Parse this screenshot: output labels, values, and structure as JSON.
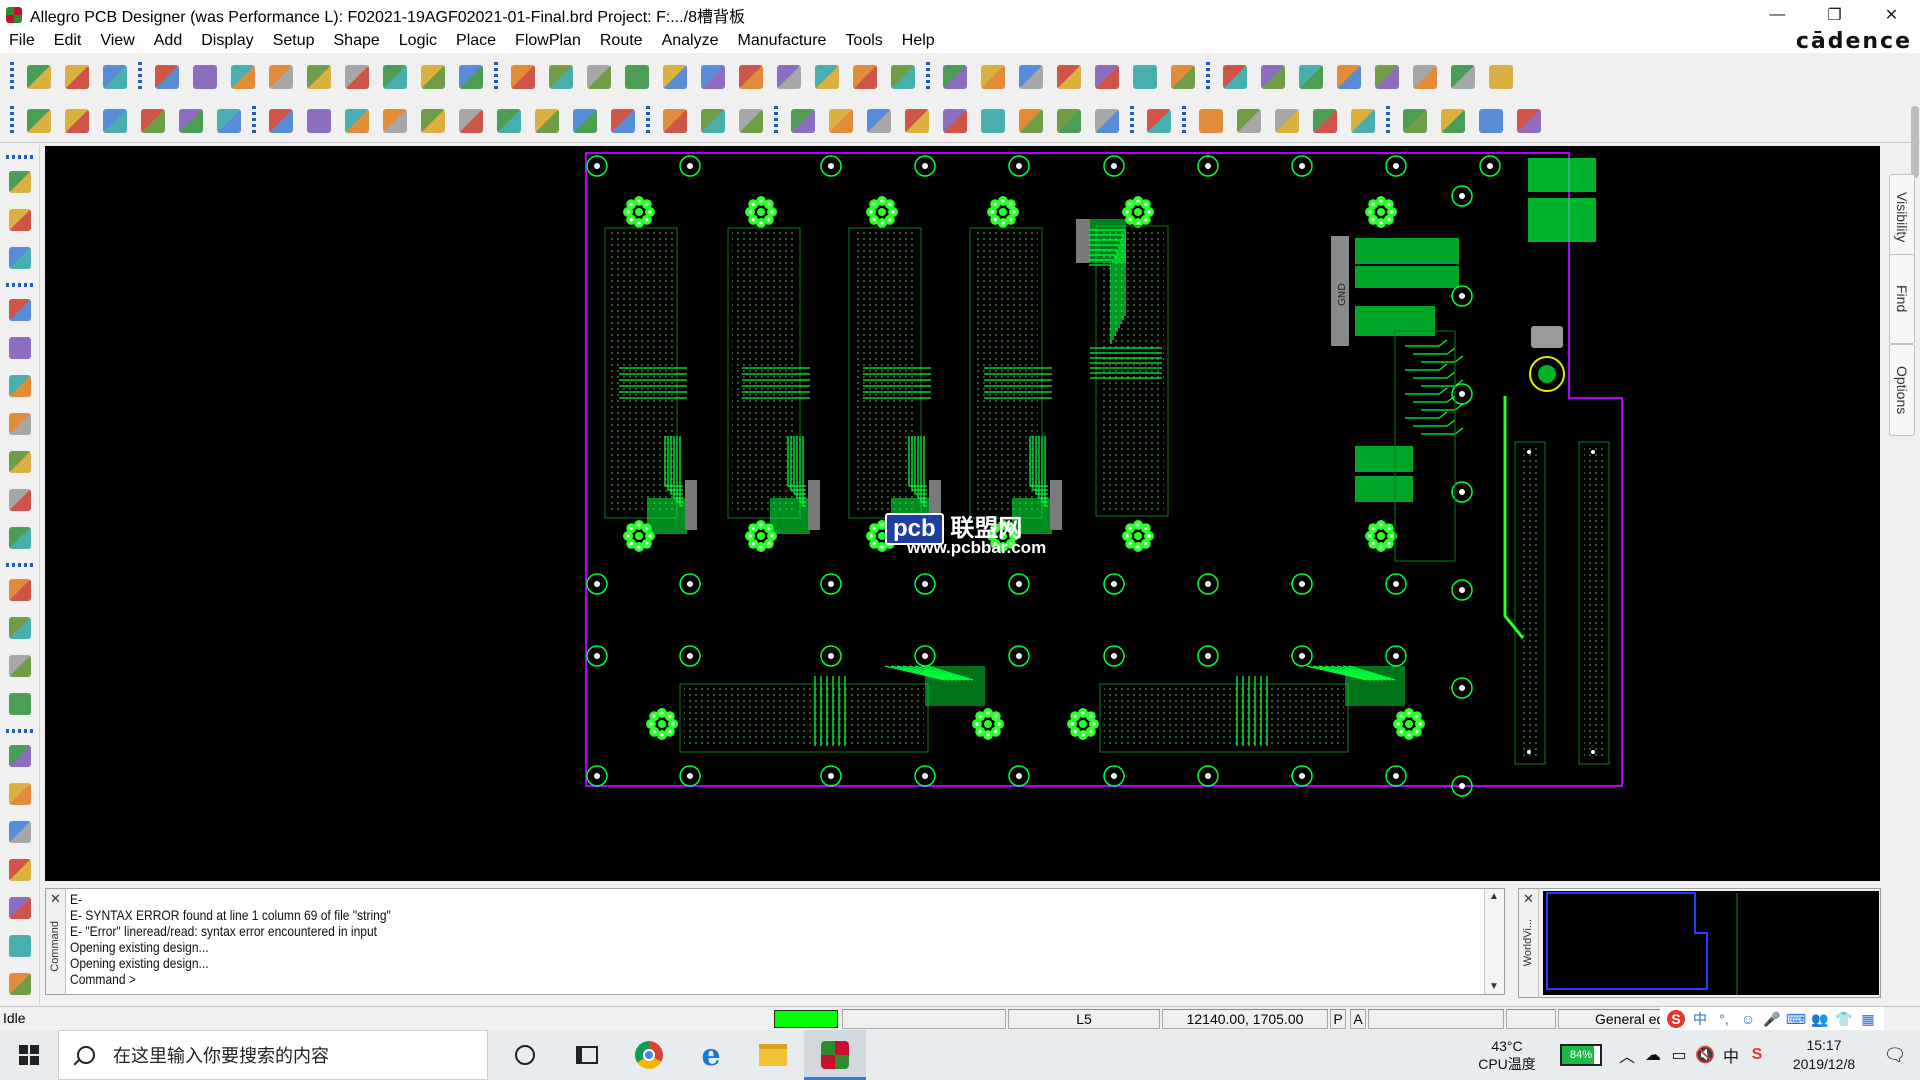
{
  "window": {
    "title": "Allegro PCB Designer (was Performance L): F02021-19AGF02021-01-Final.brd  Project: F:.../8槽背板",
    "controls": [
      "—",
      "❐",
      "✕"
    ]
  },
  "menu": {
    "items": [
      "File",
      "Edit",
      "View",
      "Add",
      "Display",
      "Setup",
      "Shape",
      "Logic",
      "Place",
      "FlowPlan",
      "Route",
      "Analyze",
      "Manufacture",
      "Tools",
      "Help"
    ],
    "brand": "cādence"
  },
  "toolbar1": {
    "groups": [
      [
        "new-file-icon",
        "open-folder-icon",
        "save-icon"
      ],
      [
        "move-icon",
        "copy-icon",
        "delete-icon",
        "undo-icon",
        "undo-down-icon",
        "redo-icon",
        "redo-down-icon",
        "add-connect-icon",
        "pin-icon"
      ],
      [
        "grid-icon",
        "design-grid-icon",
        "zoom-fit-icon",
        "zoom-in-icon",
        "zoom-in-2-icon",
        "zoom-out-icon",
        "zoom-prev-icon",
        "zoom-world-icon",
        "refresh-icon",
        "3d-icon",
        "flip-icon"
      ],
      [
        "grid-toggle-icon",
        "color-icon",
        "layers-icon",
        "stack-icon",
        "cross-section-icon",
        "spreadsheet-icon",
        "world-icon"
      ],
      [
        "info-icon",
        "show-element-icon",
        "measure-icon",
        "highlight-icon",
        "light-icon",
        "dehighlight-icon",
        "hourglass-icon",
        "cancel-icon"
      ]
    ]
  },
  "toolbar2": {
    "groups": [
      [
        "etch-icon",
        "pin-layer-icon",
        "via-layer-icon",
        "drc-icon",
        "package-icon",
        "off-icon"
      ],
      [
        "route-icon",
        "rect-icon",
        "circle-icon",
        "select-icon",
        "shape-icon",
        "void-icon",
        "square-icon",
        "poly-icon",
        "edit-shape-icon",
        "merge-icon"
      ],
      [
        "place-icon",
        "dimension-icon",
        "dimension-2-icon"
      ],
      [
        "swap-icon",
        "book-icon",
        "path-icon",
        "camera-icon",
        "ref-des-icon",
        "flag-icon",
        "chip-icon",
        "key-icon",
        "array-icon"
      ],
      [
        "waveform-icon"
      ],
      [
        "page-icon",
        "book-open-icon",
        "gift-icon",
        "wand-icon",
        "cut-icon"
      ],
      [
        "windows-icon",
        "mail-icon",
        "mail-2-icon",
        "help-icon"
      ]
    ]
  },
  "lefttoolbar": {
    "groups": [
      [
        "place-part-icon",
        "ref-icon",
        "connector-icon"
      ],
      [
        "add-connect-icon",
        "slide-icon",
        "delay-tune-icon",
        "fanout-icon",
        "bus-icon",
        "lines-icon",
        "spread-icon"
      ],
      [
        "line-icon",
        "rectangle-icon",
        "add-text-icon",
        "edit-text-icon"
      ],
      [
        "route-cross-icon",
        "route-down-icon",
        "route-x-icon",
        "route-multi-icon",
        "route-grid-icon",
        "route-diag-icon",
        "route-end-icon"
      ]
    ]
  },
  "watermark": {
    "brand": "pcb",
    "text": "联盟网",
    "url": "www.pcbbar.com"
  },
  "rightpanel": {
    "tabs": [
      "Visibility",
      "Find",
      "Options"
    ]
  },
  "board": {
    "colors": {
      "background": "#000000",
      "outline": "#b000ff",
      "etch": "#00ff3c",
      "etch_bright": "#29ff29",
      "dim": "#0a7a1a",
      "pad_white": "#ffffff",
      "outline_blue": "#3050ff"
    },
    "silk_label": "GND"
  },
  "command": {
    "panel_label": "Command",
    "lines": [
      "E-",
      "E- SYNTAX ERROR found at line 1 column 69 of file \"string\"",
      "E- \"Error\" lineread/read: syntax error encountered in input",
      "Opening existing design...",
      "Opening existing design...",
      "Command >"
    ]
  },
  "worldview": {
    "panel_label": "WorldVi..."
  },
  "status": {
    "idle": "Idle",
    "layer": "L5",
    "coords": "12140.00, 1705.00",
    "p_flag": "P",
    "a_flag": "A",
    "mode": "General edit"
  },
  "ime": {
    "items": [
      "S",
      "中",
      "°,",
      "☺",
      "🎤",
      "⌨",
      "👥",
      "👕",
      "▦"
    ]
  },
  "taskbar": {
    "search_placeholder": "在这里输入你要搜索的内容",
    "tray": {
      "temp": "43°C",
      "temp_label": "CPU温度",
      "battery": "84%",
      "symbols": [
        "︿",
        "☁",
        "▭",
        "🔇",
        "中",
        "S"
      ],
      "time": "15:17",
      "date": "2019/12/8"
    }
  }
}
